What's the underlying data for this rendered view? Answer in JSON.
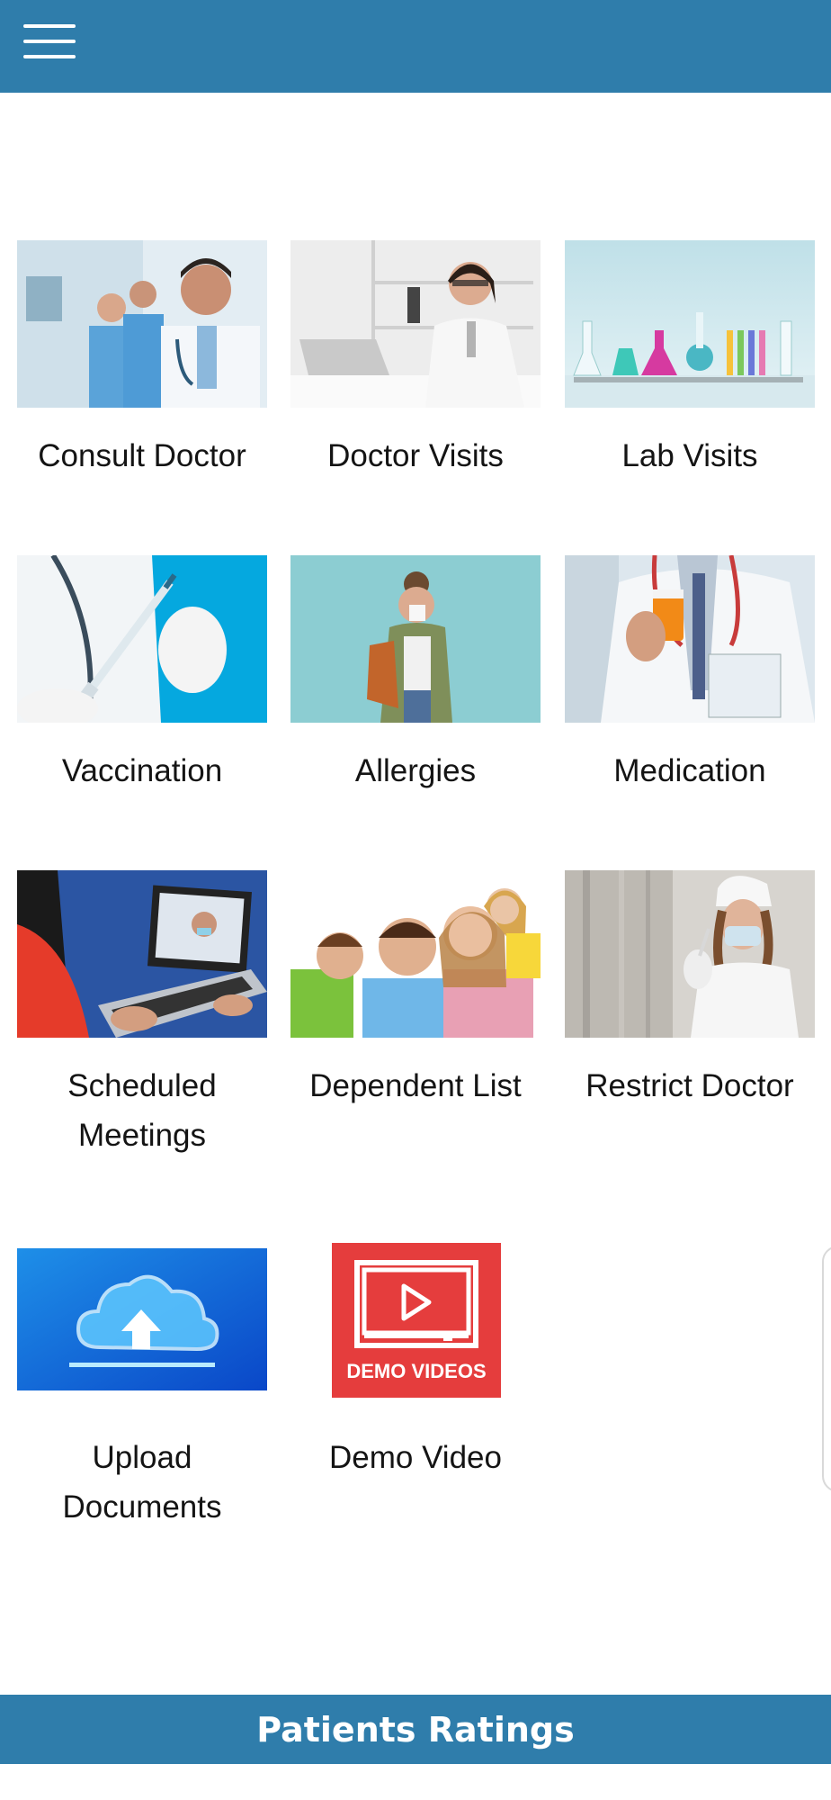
{
  "header": {
    "menu_icon": "hamburger-menu-icon",
    "bg_color": "#2f7dab"
  },
  "tiles": [
    {
      "label": "Consult Doctor",
      "image": "doctors-team-photo"
    },
    {
      "label": "Doctor Visits",
      "image": "doctor-on-phone-photo"
    },
    {
      "label": "Lab Visits",
      "image": "lab-glassware-photo"
    },
    {
      "label": "Vaccination",
      "image": "syringe-vaccine-photo"
    },
    {
      "label": "Allergies",
      "image": "woman-sneezing-photo"
    },
    {
      "label": "Medication",
      "image": "doctor-pill-bottle-photo"
    },
    {
      "label": "Scheduled Meetings",
      "image": "video-call-laptop-photo"
    },
    {
      "label": "Dependent List",
      "image": "family-photo"
    },
    {
      "label": "Restrict Doctor",
      "image": "nurse-with-mask-photo"
    },
    {
      "label": "Upload Documents",
      "image": "cloud-upload-icon"
    },
    {
      "label": "Demo Video",
      "image": "demo-videos-badge",
      "badge_text": "DEMO VIDEOS"
    }
  ],
  "footer": {
    "title": "Patients Ratings",
    "bg_color": "#2f7dab"
  }
}
